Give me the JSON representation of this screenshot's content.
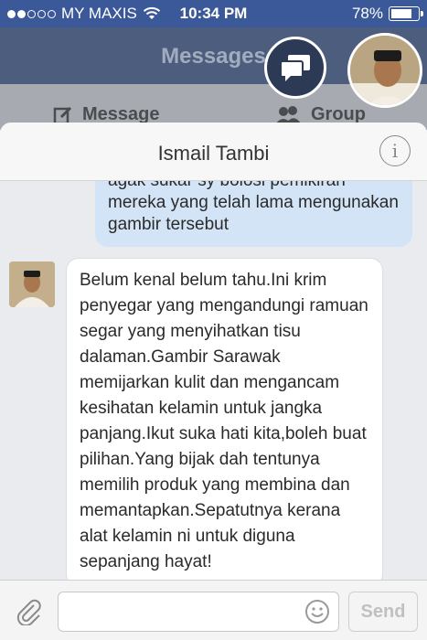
{
  "status_bar": {
    "carrier": "MY MAXIS",
    "time": "10:34 PM",
    "battery_text": "78%",
    "battery_level": 0.78
  },
  "nav": {
    "title": "Messages",
    "message_tab": "Message",
    "group_tab": "Group"
  },
  "chat": {
    "contact_name": "Ismail Tambi",
    "info_glyph": "i",
    "outgoing_message": "agak sukar sy bolosi pemikiran mereka yang telah lama mengunakan gambir tersebut",
    "incoming_message": "Belum kenal belum tahu.Ini krim penyegar yang mengandungi ramuan segar yang menyihatkan tisu dalaman.Gambir Sarawak memijarkan kulit dan mengancam kesihatan kelamin untuk jangka panjang.Ikut suka hati kita,boleh buat pilihan.Yang bijak dah tentunya memilih produk yang membina dan memantapkan.Sepatutnya kerana alat kelamin ni untuk diguna sepanjang hayat!"
  },
  "composer": {
    "input_value": "",
    "send_label": "Send"
  },
  "icons": {
    "attach": "paperclip-icon",
    "emoji": "smiley-icon",
    "chat_head": "chat-bubbles-icon",
    "wifi": "wifi-icon"
  }
}
